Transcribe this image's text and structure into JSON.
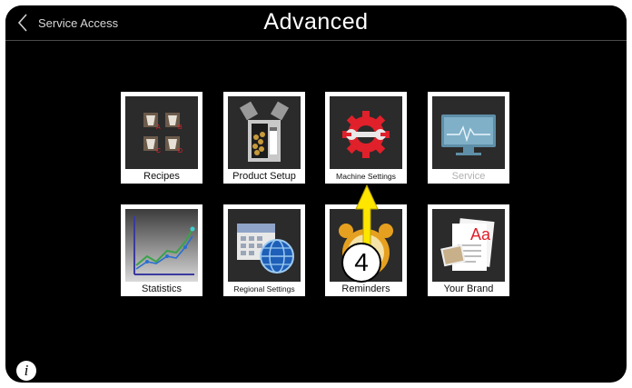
{
  "header": {
    "back_label": "Service Access",
    "title": "Advanced"
  },
  "tiles": [
    {
      "label": "Recipes",
      "icon": "recipes-cups-icon",
      "enabled": true
    },
    {
      "label": "Product Setup",
      "icon": "product-setup-canisters-icon",
      "enabled": true
    },
    {
      "label": "Machine Settings",
      "icon": "wrench-gear-icon",
      "enabled": true
    },
    {
      "label": "Service",
      "icon": "monitor-pulse-icon",
      "enabled": false
    },
    {
      "label": "Statistics",
      "icon": "line-chart-icon",
      "enabled": true
    },
    {
      "label": "Regional Settings",
      "icon": "calendar-globe-icon",
      "enabled": true
    },
    {
      "label": "Reminders",
      "icon": "alarm-clock-icon",
      "enabled": true
    },
    {
      "label": "Your Brand",
      "icon": "brand-document-icon",
      "enabled": true
    }
  ],
  "recipe_letters": [
    "A",
    "B",
    "C",
    "D"
  ],
  "brand_text": "Aa",
  "annotation": {
    "step": "4",
    "color": "#ffe600"
  },
  "colors": {
    "background": "#000000",
    "tile_bg": "#2b2b2b",
    "accent_red": "#e0202a"
  },
  "info_glyph": "i"
}
